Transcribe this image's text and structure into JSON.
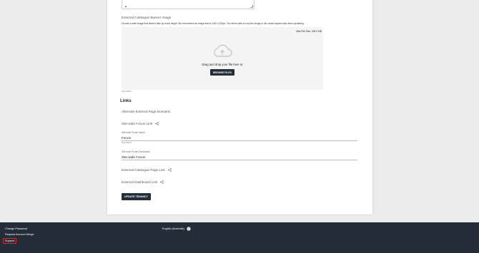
{
  "banner": {
    "label": "External Catalogue Banner Image",
    "description": "Choose a wide image that doesn't take up much height. We recommend an image that is 1440 x 320px. You will be able to crop the image to the correct aspect ratio when uploading.",
    "max_size": "Max File Size: 400.0 MB",
    "drag_text": "Drag and drop your file here or",
    "browse_label": "BROWSE FILES",
    "required": "REQUIRED"
  },
  "links": {
    "title": "Links",
    "alternate_domains": "Alternate External Page Domains",
    "forum_link": "Site-wide Forum Link",
    "forum_name_label": "Site-wide Forum Name",
    "forum_name_value": "Forum",
    "forum_name_required": "REQUIRED",
    "forum_desc_label": "Site-wide Forum Description",
    "forum_desc_value": "Site-wide Forum",
    "catalogue_link": "External Catalogue Page Link",
    "dashboard_link": "External Dashboard Link"
  },
  "actions": {
    "update_label": "UPDATE TENANCY"
  },
  "footer": {
    "change_password": "Change Password",
    "request_merge": "Request Account Merge",
    "support": "Support",
    "language": "English (Australia)"
  },
  "icons": {
    "upload": "cloud-upload-icon",
    "share": "share-icon",
    "globe": "globe-icon"
  },
  "colors": {
    "dark_button": "#222e38",
    "footer_bg": "#222d38",
    "support_highlight": "#e0242c"
  }
}
